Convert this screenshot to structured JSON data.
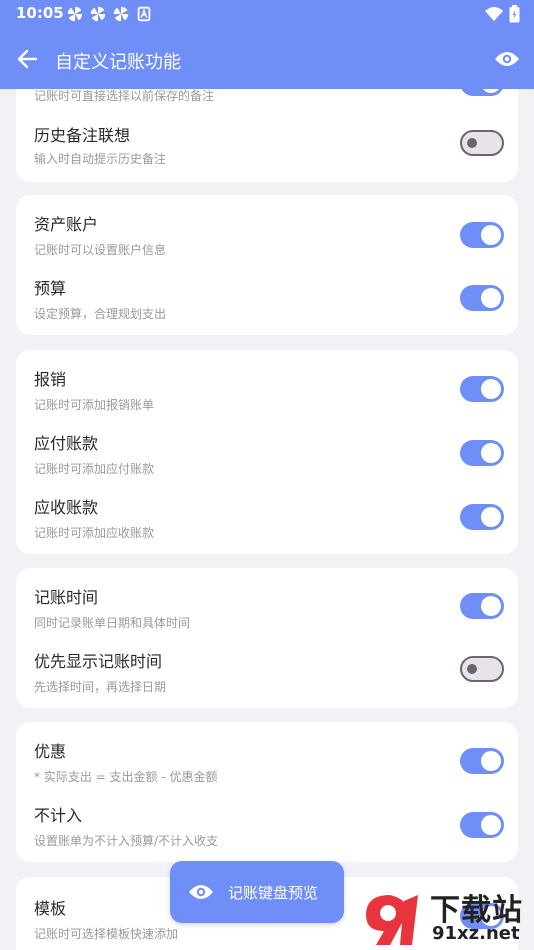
{
  "status": {
    "time": "10:05",
    "icons": [
      "pinwheel-icon",
      "pinwheel-icon",
      "pinwheel-icon",
      "notification-a-icon"
    ],
    "right_icons": [
      "wifi-icon",
      "battery-icon"
    ]
  },
  "appbar": {
    "title": "自定义记账功能",
    "back_icon": "arrow-left-icon",
    "preview_icon": "eye-icon"
  },
  "cards": [
    {
      "rows": [
        {
          "label": "",
          "desc": "记账时可直接选择以前保存的备注",
          "on": true,
          "partial": true
        },
        {
          "label": "历史备注联想",
          "desc": "输入时自动提示历史备注",
          "on": false
        }
      ]
    },
    {
      "rows": [
        {
          "label": "资产账户",
          "desc": "记账时可以设置账户信息",
          "on": true
        },
        {
          "label": "预算",
          "desc": "设定预算，合理规划支出",
          "on": true
        }
      ]
    },
    {
      "rows": [
        {
          "label": "报销",
          "desc": "记账时可添加报销账单",
          "on": true
        },
        {
          "label": "应付账款",
          "desc": "记账时可添加应付账款",
          "on": true
        },
        {
          "label": "应收账款",
          "desc": "记账时可添加应收账款",
          "on": true
        }
      ]
    },
    {
      "rows": [
        {
          "label": "记账时间",
          "desc": "同时记录账单日期和具体时间",
          "on": true
        },
        {
          "label": "优先显示记账时间",
          "desc": "先选择时间，再选择日期",
          "on": false
        }
      ]
    },
    {
      "rows": [
        {
          "label": "优惠",
          "desc": "* 实际支出 = 支出金额 - 优惠金额",
          "on": true
        },
        {
          "label": "不计入",
          "desc": "设置账单为不计入预算/不计入收支",
          "on": true
        }
      ]
    },
    {
      "rows": [
        {
          "label": "模板",
          "desc": "记账时可选择模板快速添加",
          "on": true
        }
      ]
    }
  ],
  "fab": {
    "label": "记账键盘预览",
    "icon": "eye-icon"
  },
  "watermark": {
    "big": "下载站",
    "small": "91xz.net"
  },
  "colors": {
    "accent": "#6f8ef7",
    "background": "#f2f2f6",
    "toggle_off_bg": "#e8e2ea",
    "toggle_off_border": "#6b6570",
    "watermark_red": "#e8343c"
  }
}
